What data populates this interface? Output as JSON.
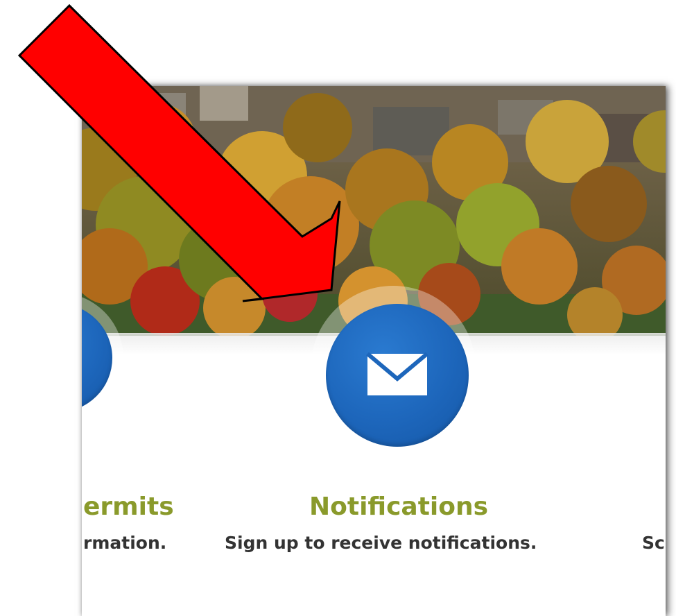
{
  "tiles": [
    {
      "title": "ermits",
      "description": "rmation."
    },
    {
      "title": "Notifications",
      "description": "Sign up to receive notifications.",
      "icon": "envelope-icon"
    },
    {
      "title": "",
      "description": "Sc"
    }
  ],
  "colors": {
    "accent_circle": "#1d66bb",
    "title_green": "#8a9a2b",
    "annotation_arrow": "#ff0000"
  }
}
